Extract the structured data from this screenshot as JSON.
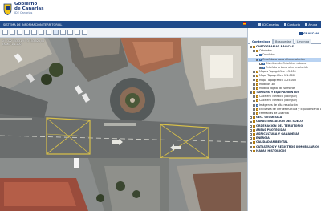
{
  "header": {
    "logo_line1": "Gobierno",
    "logo_line2": "de Canarias",
    "logo_sub": "IDE Canarias",
    "bar_title": "SISTEMA DE INFORMACIÓN TERRITORIAL",
    "links": [
      "3D/Canarias",
      "Contacto",
      "Ayuda"
    ]
  },
  "map": {
    "coords_line1": "X= 372 453,31   Y= 3 153 521,08",
    "coords_line2": "Escala 1:1.200"
  },
  "panel": {
    "logo": "GRAFCAN",
    "tabs": [
      "Contenidos",
      "Búsquedas",
      "Leyenda"
    ],
    "active_tab": 0,
    "tree": [
      {
        "label": "CARTOGRAFÍAS BÁSICAS",
        "indent": 1,
        "type": "cat",
        "checked": true
      },
      {
        "label": "Ortofotos",
        "indent": 2,
        "type": "folder",
        "checked": true
      },
      {
        "label": "Ortofotos",
        "indent": 3,
        "type": "sub",
        "checked": false
      },
      {
        "label": "Ortofoto urbana alta resolución",
        "indent": 3,
        "type": "item",
        "checked": true,
        "selected": true
      },
      {
        "label": "Distribución Ortofotos urbana",
        "indent": 4,
        "type": "sub",
        "checked": false
      },
      {
        "label": "Ortofoto urbana alta resolución",
        "indent": 4,
        "type": "sub",
        "checked": true
      },
      {
        "label": "Mapas Topográfico 1:5.000",
        "indent": 2,
        "type": "folder",
        "checked": false
      },
      {
        "label": "Mapa Topográfico 1:1.000",
        "indent": 2,
        "type": "folder",
        "checked": false
      },
      {
        "label": "Mapa Topográfico 1:25.000",
        "indent": 2,
        "type": "folder",
        "checked": false
      },
      {
        "label": "Modelos 3D",
        "indent": 2,
        "type": "folder",
        "checked": false
      },
      {
        "label": "Modelo digital de sombras",
        "indent": 2,
        "type": "folder",
        "checked": false
      },
      {
        "label": "TURISMO Y EQUIPAMIENTOS",
        "indent": 1,
        "type": "cat",
        "checked": true
      },
      {
        "label": "Callejero Turístico (bilingüe)",
        "indent": 2,
        "type": "folder",
        "checked": true
      },
      {
        "label": "Callejero Turístico (bilingüe)",
        "indent": 2,
        "type": "folder",
        "checked": false
      },
      {
        "label": "Imágenes de alta resolución",
        "indent": 2,
        "type": "item",
        "checked": false
      },
      {
        "label": "Encuesta de Infraestructura y Equipamiento Local",
        "indent": 2,
        "type": "folder",
        "checked": false
      },
      {
        "label": "Farmacias de Guardia",
        "indent": 2,
        "type": "folder",
        "checked": false
      },
      {
        "label": "GEO. GEODÉSICA",
        "indent": 1,
        "type": "cat",
        "checked": false
      },
      {
        "label": "CARACTERIZACIÓN DEL SUELO",
        "indent": 1,
        "type": "cat",
        "checked": false
      },
      {
        "label": "ORDENACIÓN DEL TERRITORIO",
        "indent": 1,
        "type": "cat",
        "checked": false
      },
      {
        "label": "ÁREAS PROTEGIDAS",
        "indent": 1,
        "type": "cat",
        "checked": false
      },
      {
        "label": "AGRICULTURA Y GANADERÍA",
        "indent": 1,
        "type": "cat",
        "checked": false
      },
      {
        "label": "ENERGÍA",
        "indent": 1,
        "type": "cat",
        "checked": false
      },
      {
        "label": "CALIDAD AMBIENTAL",
        "indent": 1,
        "type": "cat",
        "checked": false
      },
      {
        "label": "CATASTROS Y REGISTROS INMOBILIARIOS",
        "indent": 1,
        "type": "cat",
        "checked": false
      },
      {
        "label": "MAPAS HISTÓRICOS",
        "indent": 1,
        "type": "cat",
        "checked": false
      }
    ]
  },
  "colors": {
    "bar": "#1f4a8a",
    "selected_row": "#b9d3f2"
  }
}
